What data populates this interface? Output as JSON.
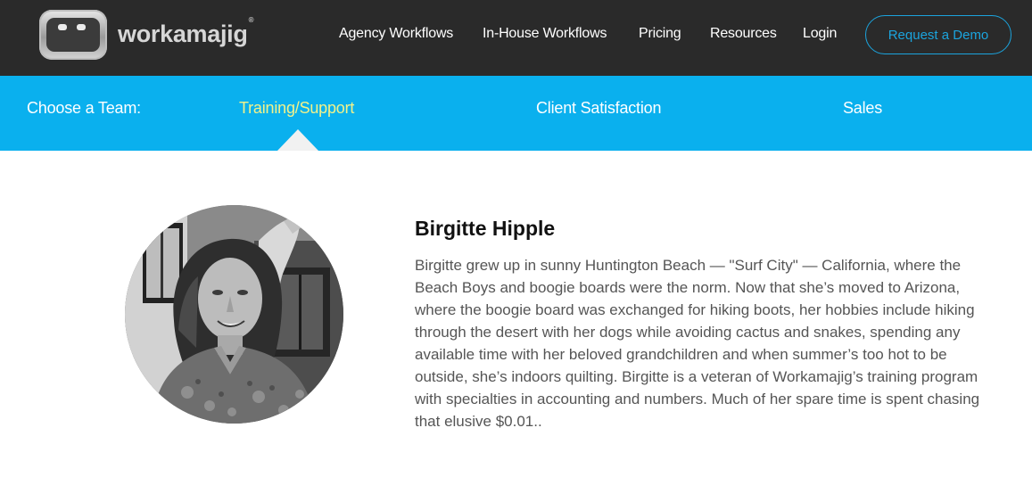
{
  "brand": {
    "name": "workamajig",
    "registered_mark": "®"
  },
  "nav": {
    "items": [
      {
        "label": "Agency Workflows"
      },
      {
        "label": "In-House Workflows"
      },
      {
        "label": "Pricing"
      },
      {
        "label": "Resources"
      },
      {
        "label": "Login"
      }
    ],
    "cta_label": "Request a Demo"
  },
  "teams": {
    "prompt": "Choose a Team:",
    "tabs": [
      {
        "label": "Training/Support",
        "active": true
      },
      {
        "label": "Client Satisfaction",
        "active": false
      },
      {
        "label": "Sales",
        "active": false
      }
    ]
  },
  "profile": {
    "name": "Birgitte Hipple",
    "bio": "Birgitte grew up in sunny Huntington Beach — \"Surf City\" — California, where the Beach Boys and boogie boards were the norm. Now that she’s moved to Arizona, where the boogie board was exchanged for hiking boots, her hobbies include hiking through the desert with her dogs while avoiding cactus and snakes, spending any available time with her beloved grandchildren and when summer’s too hot to be outside, she’s indoors quilting. Birgitte is a veteran of Workamajig’s training program with specialties in accounting and numbers. Much of her spare time is spent chasing that elusive $0.01.."
  },
  "colors": {
    "topbar_bg": "#2a2a2a",
    "team_bar_bg": "#0ab0ee",
    "active_team": "#f2f28a",
    "cta_accent": "#1ba4de",
    "bio_text": "#555555"
  }
}
